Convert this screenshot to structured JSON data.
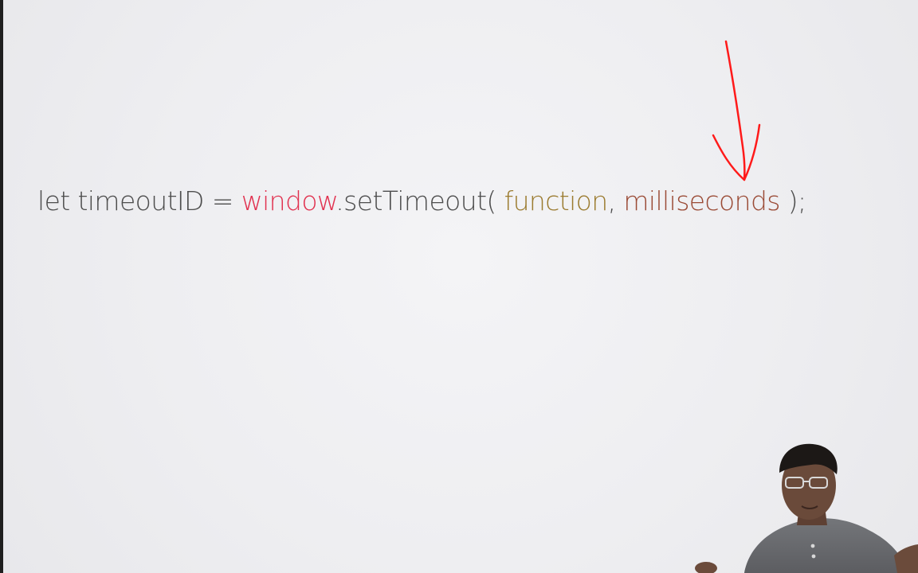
{
  "slide": {
    "code": {
      "keyword_let": "let",
      "variable_name": "timeoutID",
      "assign_op": "=",
      "object_name": "window",
      "dot": ".",
      "method_name": "setTimeout(",
      "param_function": "function",
      "comma": ",",
      "param_milliseconds": "milliseconds",
      "close": ");"
    }
  },
  "annotation": {
    "type": "hand-drawn-arrow",
    "color": "#ff0000",
    "points_to": "milliseconds"
  },
  "presenter_video": {
    "shirt_color": "#6a6b6e",
    "skin_color": "#6a4a3a"
  },
  "colors": {
    "background": "#efeff1",
    "text": "#4d4d4d",
    "window": "#e1314f",
    "function": "#9b7b2f",
    "milliseconds": "#9a4a35"
  }
}
